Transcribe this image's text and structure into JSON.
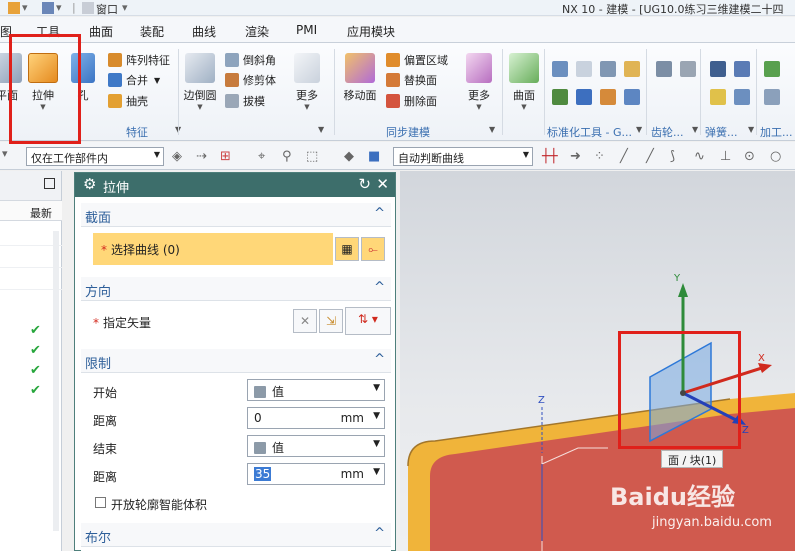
{
  "title_bar": {
    "menu_label": "窗口",
    "app_title": "NX 10 - 建模 - [UG10.0练习三维建模二十四"
  },
  "menu_tabs": [
    "图",
    "工具",
    "曲面",
    "装配",
    "曲线",
    "渲染",
    "PMI",
    "应用模块"
  ],
  "ribbon": {
    "face_label": "平面",
    "extrude_label": "拉伸",
    "hole_label": "孔",
    "array_feature": "阵列特征",
    "combine": "合并",
    "shell": "抽壳",
    "feature_group_label": "特征",
    "edge_blend": "边倒圆",
    "chamfer": "倒斜角",
    "trim_body": "修剪体",
    "draft": "拔模",
    "more_1": "更多",
    "move_face": "移动面",
    "offset_region": "偏置区域",
    "replace_face": "替换面",
    "delete_face": "删除面",
    "sync_group_label": "同步建模",
    "more_2": "更多",
    "surface": "曲面",
    "std_tools_label": "标准化工具 - G...",
    "gear_label": "齿轮...",
    "spring_label": "弹簧...",
    "process_label": "加工..."
  },
  "toolbar": {
    "scope_value": "仅在工作部件内",
    "curve_rule": "自动判断曲线"
  },
  "navigator": {
    "col_latest": "最新",
    "rows_checked": 4
  },
  "dialog": {
    "title": "拉伸",
    "section_title": "截面",
    "select_curve": "选择曲线 (0)",
    "direction_title": "方向",
    "specify_vector": "指定矢量",
    "limits_title": "限制",
    "start_label": "开始",
    "start_value": "值",
    "distance_label": "距离",
    "distance_start": "0",
    "end_label": "结束",
    "end_value": "值",
    "distance_end": "35",
    "unit": "mm",
    "open_profile": "开放轮廓智能体积",
    "boolean_title": "布尔"
  },
  "viewport": {
    "selection_tip": "面 / 块(1)",
    "axis_x": "X",
    "axis_y": "Y",
    "axis_z": "Z",
    "watermark": "Baidu经验",
    "watermark_url": "jingyan.baidu.com"
  },
  "colors": {
    "dialog_header": "#3d6e6b",
    "selection_yellow": "#ffd778",
    "annotation_red": "#e0201a",
    "part_face": "#d05a4e",
    "part_edge": "#f0b43a"
  }
}
